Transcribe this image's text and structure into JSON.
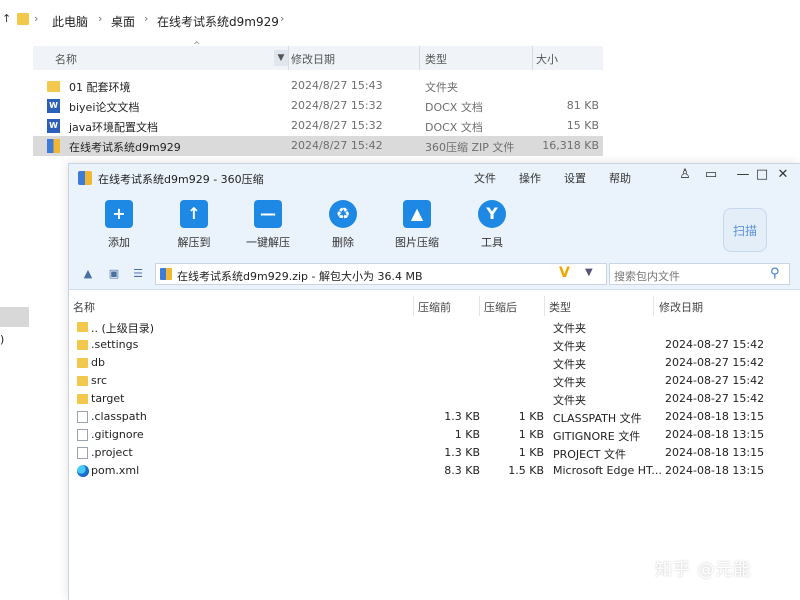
{
  "explorer": {
    "breadcrumb": [
      "此电脑",
      "桌面",
      "在线考试系统d9m929"
    ],
    "columns": [
      "名称",
      "修改日期",
      "类型",
      "大小"
    ],
    "sort_caret": "^",
    "rows": [
      {
        "name": "01 配套环境",
        "date": "2024/8/27 15:43",
        "type": "文件夹",
        "size": "",
        "icon": "folder-icon"
      },
      {
        "name": "biyei论文文档",
        "date": "2024/8/27 15:32",
        "type": "DOCX 文档",
        "size": "81 KB",
        "icon": "word-icon"
      },
      {
        "name": "java环境配置文档",
        "date": "2024/8/27 15:32",
        "type": "DOCX 文档",
        "size": "15 KB",
        "icon": "word-icon"
      },
      {
        "name": "在线考试系统d9m929",
        "date": "2024/8/27 15:42",
        "type": "360压缩 ZIP 文件",
        "size": "16,318 KB",
        "icon": "zip-icon"
      }
    ],
    "left_edge_text": ")"
  },
  "zipwin": {
    "title": "在线考试系统d9m929 - 360压缩",
    "menu": [
      "文件",
      "操作",
      "设置",
      "帮助"
    ],
    "toolbar": [
      {
        "label": "添加",
        "icon": "add-icon",
        "glyph": "+"
      },
      {
        "label": "解压到",
        "icon": "extract-icon",
        "glyph": "↑"
      },
      {
        "label": "一键解压",
        "icon": "one-click-extract-icon",
        "glyph": "—"
      },
      {
        "label": "删除",
        "icon": "delete-icon",
        "glyph": "♻"
      },
      {
        "label": "图片压缩",
        "icon": "image-compress-icon",
        "glyph": "▲"
      },
      {
        "label": "工具",
        "icon": "tools-icon",
        "glyph": "Y"
      }
    ],
    "scan_label": "扫描",
    "path_text": "在线考试系统d9m929.zip - 解包大小为 36.4 MB",
    "search_placeholder": "搜索包内文件",
    "columns": [
      "名称",
      "压缩前",
      "压缩后",
      "类型",
      "修改日期"
    ],
    "rows": [
      {
        "name": ".. (上级目录)",
        "before": "",
        "after": "",
        "type": "文件夹",
        "date": "",
        "icon": "folder-icon"
      },
      {
        "name": ".settings",
        "before": "",
        "after": "",
        "type": "文件夹",
        "date": "2024-08-27 15:42",
        "icon": "folder-icon"
      },
      {
        "name": "db",
        "before": "",
        "after": "",
        "type": "文件夹",
        "date": "2024-08-27 15:42",
        "icon": "folder-icon"
      },
      {
        "name": "src",
        "before": "",
        "after": "",
        "type": "文件夹",
        "date": "2024-08-27 15:42",
        "icon": "folder-icon"
      },
      {
        "name": "target",
        "before": "",
        "after": "",
        "type": "文件夹",
        "date": "2024-08-27 15:42",
        "icon": "folder-icon"
      },
      {
        "name": ".classpath",
        "before": "1.3 KB",
        "after": "1 KB",
        "type": "CLASSPATH 文件",
        "date": "2024-08-18 13:15",
        "icon": "file-icon"
      },
      {
        "name": ".gitignore",
        "before": "1 KB",
        "after": "1 KB",
        "type": "GITIGNORE 文件",
        "date": "2024-08-18 13:15",
        "icon": "file-icon"
      },
      {
        "name": ".project",
        "before": "1.3 KB",
        "after": "1 KB",
        "type": "PROJECT 文件",
        "date": "2024-08-18 13:15",
        "icon": "file-icon"
      },
      {
        "name": "pom.xml",
        "before": "8.3 KB",
        "after": "1.5 KB",
        "type": "Microsoft Edge HT...",
        "date": "2024-08-18 13:15",
        "icon": "edge-icon"
      }
    ]
  },
  "watermark": "知乎 @元能"
}
